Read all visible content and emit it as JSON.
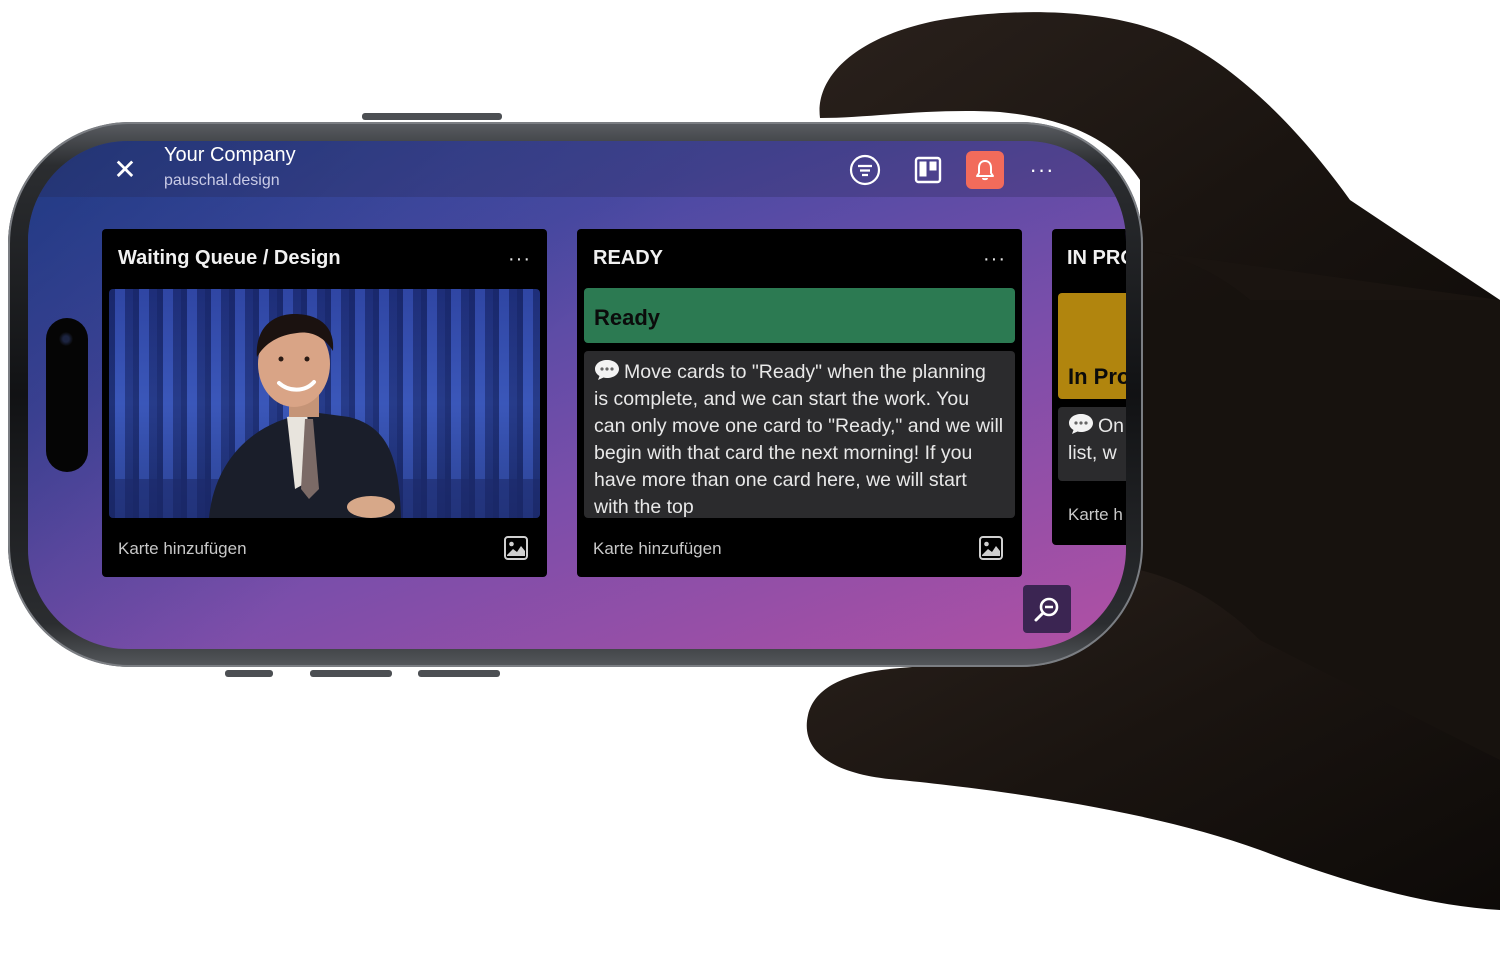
{
  "header": {
    "title": "Your Company",
    "subtitle": "pauschal.design",
    "close_icon": "close-icon",
    "filter_icon": "filter-icon",
    "board_icon": "board-icon",
    "bell_icon": "bell-icon",
    "more_icon": "more-icon"
  },
  "lists": [
    {
      "title": "Waiting Queue / Design",
      "menu": "···",
      "add_card": "Karte hinzufügen",
      "card_image_alt": "Man in suit in front of blue curtain"
    },
    {
      "title": "READY",
      "menu": "···",
      "label": "Ready",
      "label_color": "#2c7a52",
      "card_text": "Move cards to \"Ready\" when the planning is complete, and we can start the work. You can only move one card to \"Ready,\" and we will begin with that card the next morning! If you have more than one card here, we will start with the top",
      "add_card": "Karte hinzufügen"
    },
    {
      "title": "IN PRO",
      "label": "In Pro",
      "label_color": "#b1850e",
      "card_text_line1": "On",
      "card_text_line2": "list, w",
      "add_card": "Karte h"
    }
  ],
  "colors": {
    "accent_bell": "#f26b5b",
    "zoom_button": "#3b2552"
  }
}
